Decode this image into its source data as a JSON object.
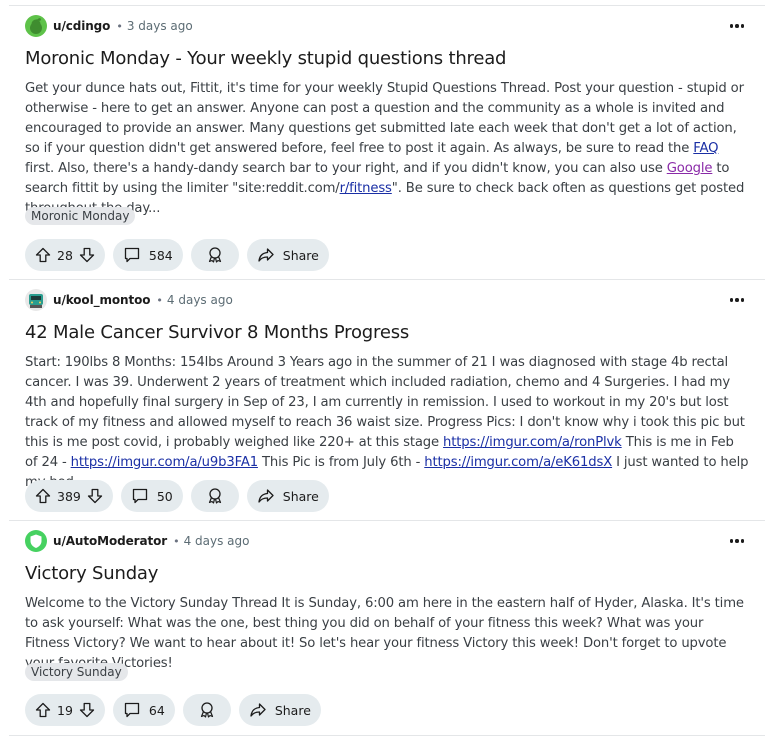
{
  "posts": [
    {
      "author": "u/cdingo",
      "avatar_icon": "snoo-avatar-icon",
      "avatar_color": "#5ec249",
      "time": "3 days ago",
      "title": "Moronic Monday - Your weekly stupid questions thread",
      "body_parts": [
        {
          "t": "Get your dunce hats out, Fittit, it's time for your weekly Stupid Questions Thread. Post your question - stupid or otherwise - here to get an answer. Anyone can post a question and the community as a whole is invited and encouraged to provide an answer. Many questions get submitted late each week that don't get a lot of action, so if your question didn't get answered before, feel free to post it again. As always, be sure to read the "
        },
        {
          "link": "FAQ"
        },
        {
          "t": " first. Also, there's a handy-dandy search bar to your right, and if you didn't know, you can also use "
        },
        {
          "link": "Google",
          "visited": true
        },
        {
          "t": " to search fittit by using the limiter \"site:reddit.com/"
        },
        {
          "link": "r/fitness"
        },
        {
          "t": "\". Be sure to check back often as questions get posted throughout the day..."
        }
      ],
      "flair": "Moronic Monday",
      "votes": "28",
      "comments": "584",
      "share_label": "Share"
    },
    {
      "author": "u/kool_montoo",
      "avatar_icon": "truck-avatar-icon",
      "avatar_color": "#2a9d8f",
      "time": "4 days ago",
      "title": "42 Male Cancer Survivor 8 Months Progress",
      "body_parts": [
        {
          "t": "Start: 190lbs 8 Months: 154lbs Around 3 Years ago in the summer of 21 I was diagnosed with stage 4b rectal cancer. I was 39. Underwent 2 years of treatment which included radiation, chemo and 4 Surgeries. I had my 4th and hopefully final surgery in Sep of 23, I am currently in remission. I used to workout in my 20's but lost track of my fitness and allowed myself to reach 36 waist size. Progress Pics: I don't know why i took this pic but this is me post covid, i probably weighed like 220+ at this stage "
        },
        {
          "link": "https://imgur.com/a/ronPlvk"
        },
        {
          "t": " This is me in Feb of 24 - "
        },
        {
          "link": "https://imgur.com/a/u9b3FA1"
        },
        {
          "t": " This Pic is from July 6th - "
        },
        {
          "link": "https://imgur.com/a/eK61dsX"
        },
        {
          "t": " I just wanted to help my bod..."
        }
      ],
      "flair": null,
      "votes": "389",
      "comments": "50",
      "share_label": "Share"
    },
    {
      "author": "u/AutoModerator",
      "avatar_icon": "shield-avatar-icon",
      "avatar_color": "#46d160",
      "time": "4 days ago",
      "title": "Victory Sunday",
      "body_parts": [
        {
          "t": "Welcome to the Victory Sunday Thread It is Sunday, 6:00 am here in the eastern half of Hyder, Alaska. It's time to ask yourself: What was the one, best thing you did on behalf of your fitness this week? What was your Fitness Victory? We want to hear about it! So let's hear your fitness Victory this week! Don't forget to upvote your favorite Victories!"
        }
      ],
      "flair": "Victory Sunday",
      "votes": "19",
      "comments": "64",
      "share_label": "Share"
    }
  ]
}
